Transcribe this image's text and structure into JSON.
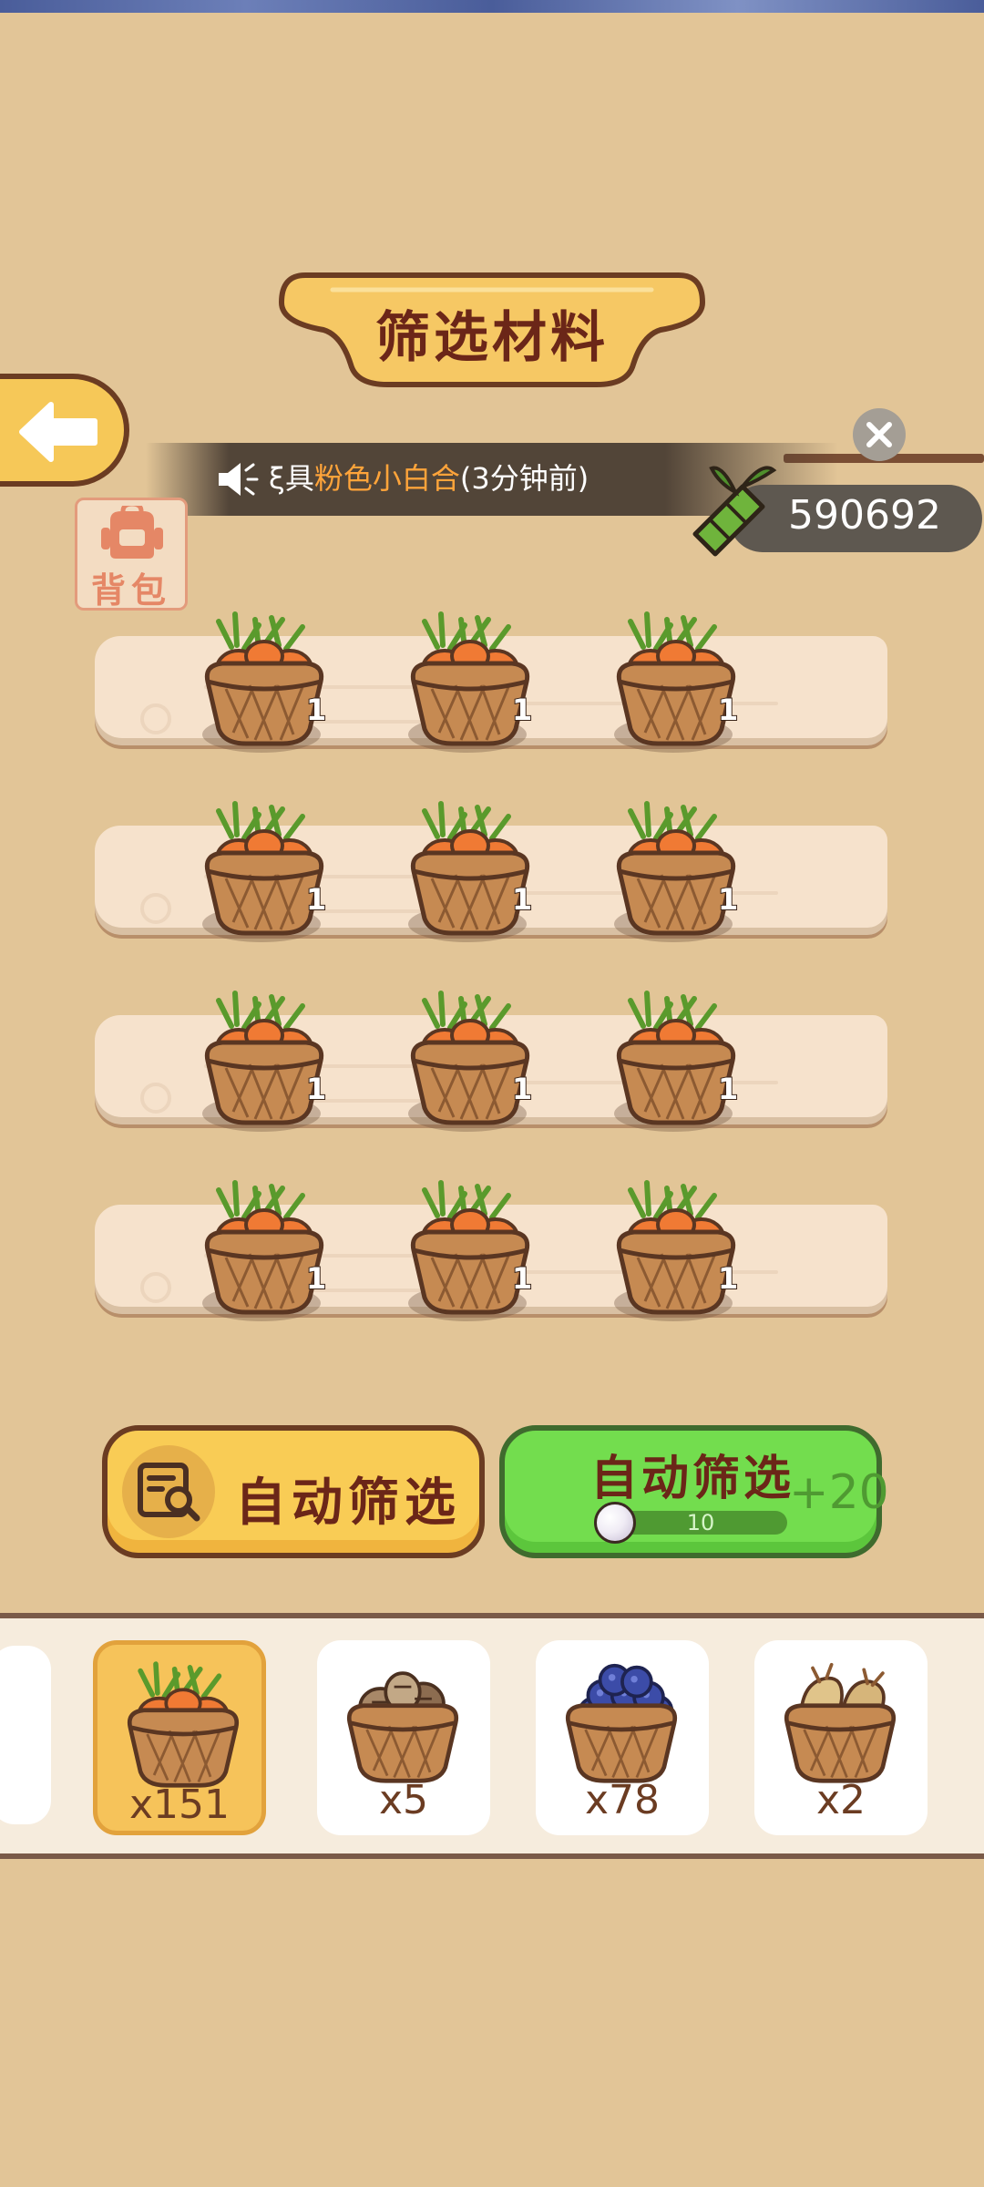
{
  "title": "筛选材料",
  "notice": {
    "prefix": "ξ具",
    "highlight": "粉色小白合",
    "suffix": "(3分钟前)"
  },
  "currency": {
    "value": "590692",
    "icon": "bamboo-icon"
  },
  "backpack": {
    "label": "背包"
  },
  "shelves": [
    {
      "items": [
        {
          "count": "1"
        },
        {
          "count": "1"
        },
        {
          "count": "1"
        }
      ]
    },
    {
      "items": [
        {
          "count": "1"
        },
        {
          "count": "1"
        },
        {
          "count": "1"
        }
      ]
    },
    {
      "items": [
        {
          "count": "1"
        },
        {
          "count": "1"
        },
        {
          "count": "1"
        }
      ]
    },
    {
      "items": [
        {
          "count": "1"
        },
        {
          "count": "1"
        },
        {
          "count": "1"
        }
      ]
    }
  ],
  "buttons": {
    "auto_filter": "自动筛选",
    "auto_filter_paid": {
      "label": "自动筛选",
      "bonus": "+20",
      "cost": "10"
    }
  },
  "inventory": [
    {
      "name": "carrot",
      "qty": "x151",
      "selected": true
    },
    {
      "name": "taro",
      "qty": "x5",
      "selected": false
    },
    {
      "name": "blueberry",
      "qty": "x78",
      "selected": false
    },
    {
      "name": "ginger",
      "qty": "x2",
      "selected": false
    }
  ],
  "colors": {
    "background": "#e2c597",
    "title_text": "#6b2618",
    "highlight": "#ffa43a",
    "yellow_button": "#f9cc55",
    "green_button": "#73dd4e"
  }
}
